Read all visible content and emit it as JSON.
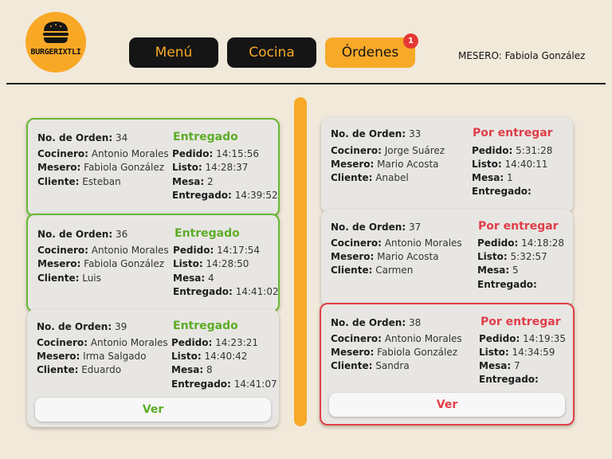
{
  "logo": {
    "text": "BURGERIXTLI",
    "icon": "burger-icon",
    "color": "#f9a826"
  },
  "nav": {
    "menu_label": "Menú",
    "kitchen_label": "Cocina",
    "orders_label": "Órdenes",
    "orders_badge": "1"
  },
  "waiter": "MESERO: Fabiola González",
  "labels": {
    "order_no": "No. de Orden:",
    "cook": "Cocinero:",
    "waiter": "Mesero:",
    "client": "Cliente:",
    "ordered": "Pedido:",
    "ready": "Listo:",
    "table": "Mesa:",
    "delivered": "Entregado:"
  },
  "colors": {
    "accent": "#f7a928",
    "delivered": "#5cad27",
    "pending": "#e03e48"
  },
  "left_orders": [
    {
      "number": "34",
      "status": "Entregado",
      "cook": "Antonio Morales",
      "waiter": "Fabiola González",
      "client": "Esteban",
      "ordered": "14:15:56",
      "ready": "14:28:37",
      "table": "2",
      "delivered": "14:39:52"
    },
    {
      "number": "36",
      "status": "Entregado",
      "cook": "Antonio Morales",
      "waiter": "Fabiola González",
      "client": "Luis",
      "ordered": "14:17:54",
      "ready": "14:28:50",
      "table": "4",
      "delivered": "14:41:02"
    },
    {
      "number": "39",
      "status": "Entregado",
      "cook": "Antonio Morales",
      "waiter": "Irma Salgado",
      "client": "Eduardo",
      "ordered": "14:23:21",
      "ready": "14:40:42",
      "table": "8",
      "delivered": "14:41:07",
      "button": "Ver"
    }
  ],
  "right_orders": [
    {
      "number": "33",
      "status": "Por entregar",
      "cook": "Jorge Suárez",
      "waiter": "Mario Acosta",
      "client": "Anabel",
      "ordered": "5:31:28",
      "ready": "14:40:11",
      "table": "1",
      "delivered": ""
    },
    {
      "number": "37",
      "status": "Por entregar",
      "cook": "Antonio Morales",
      "waiter": "Mario Acosta",
      "client": "Carmen",
      "ordered": "14:18:28",
      "ready": "5:32:57",
      "table": "5",
      "delivered": ""
    },
    {
      "number": "38",
      "status": "Por entregar",
      "cook": "Antonio Morales",
      "waiter": "Fabiola González",
      "client": "Sandra",
      "ordered": "14:19:35",
      "ready": "14:34:59",
      "table": "7",
      "delivered": "",
      "button": "Ver"
    }
  ]
}
